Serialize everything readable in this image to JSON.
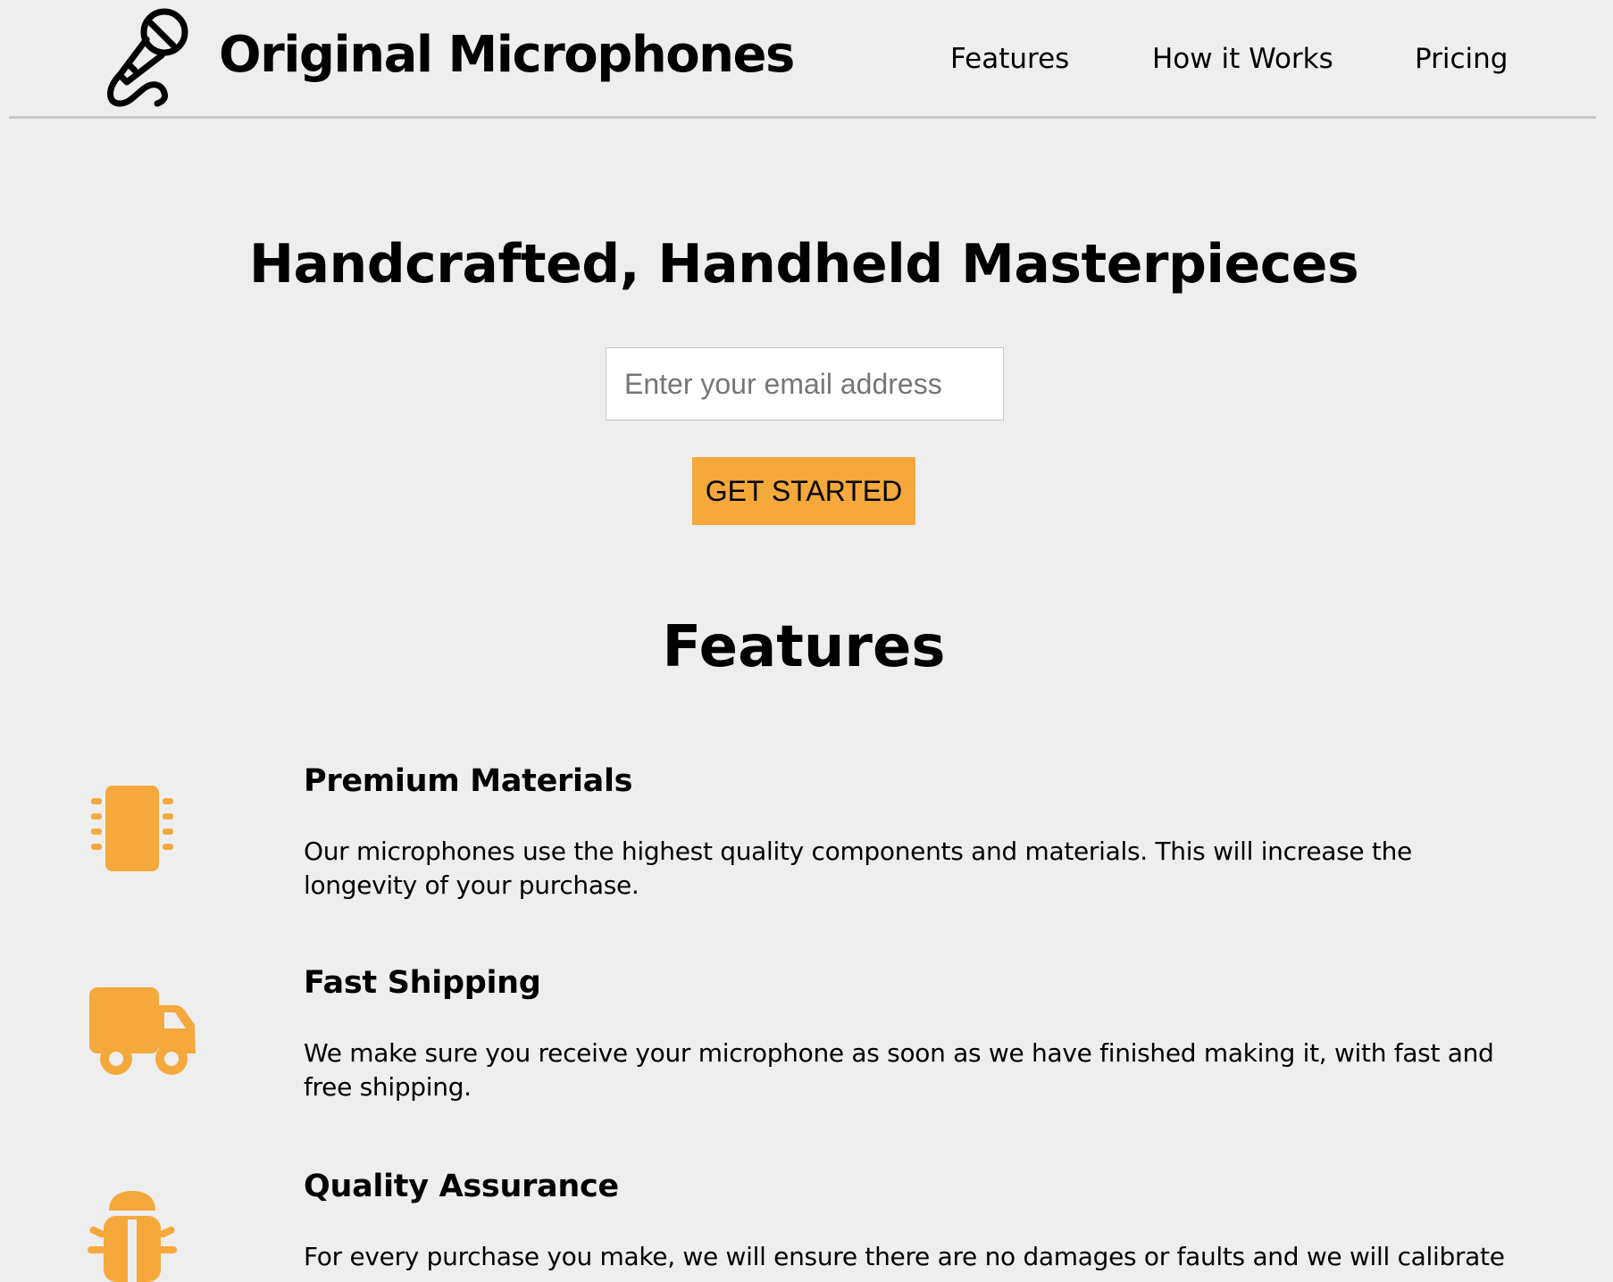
{
  "header": {
    "brand": "Original Microphones",
    "nav": [
      {
        "label": "Features"
      },
      {
        "label": "How it Works"
      },
      {
        "label": "Pricing"
      }
    ]
  },
  "hero": {
    "title": "Handcrafted, Handheld Masterpieces",
    "email_placeholder": "Enter your email address",
    "cta_label": "GET STARTED"
  },
  "features": {
    "title": "Features",
    "items": [
      {
        "icon": "chip-icon",
        "heading": "Premium Materials",
        "text": "Our microphones use the highest quality components and materials. This will increase the longevity of your purchase."
      },
      {
        "icon": "truck-icon",
        "heading": "Fast Shipping",
        "text": "We make sure you receive your microphone as soon as we have finished making it, with fast and free shipping."
      },
      {
        "icon": "bug-icon",
        "heading": "Quality Assurance",
        "text": "For every purchase you make, we will ensure there are no damages or faults and we will calibrate"
      }
    ]
  },
  "colors": {
    "accent": "#f5a83b",
    "background": "#eeeeee",
    "divider": "#c8c8c8"
  }
}
